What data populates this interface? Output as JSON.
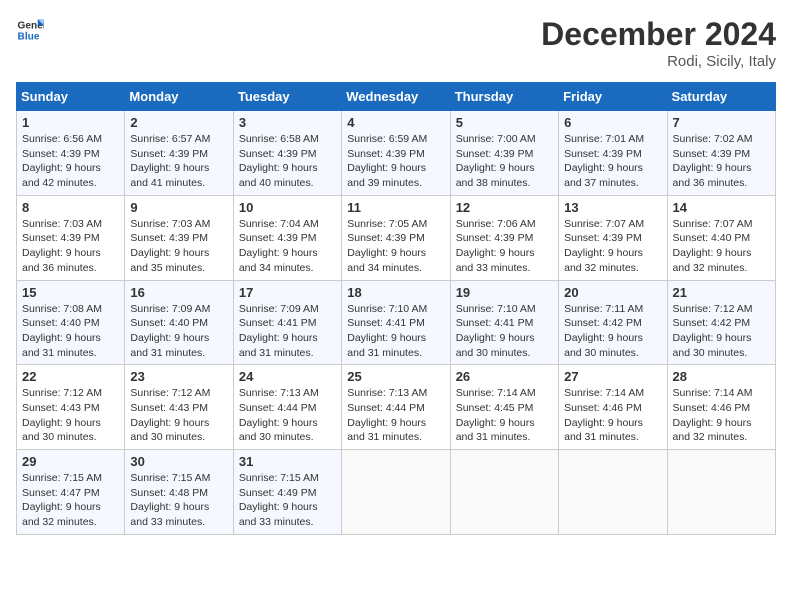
{
  "logo": {
    "line1": "General",
    "line2": "Blue"
  },
  "title": "December 2024",
  "location": "Rodi, Sicily, Italy",
  "weekdays": [
    "Sunday",
    "Monday",
    "Tuesday",
    "Wednesday",
    "Thursday",
    "Friday",
    "Saturday"
  ],
  "weeks": [
    [
      {
        "day": "1",
        "sunrise": "6:56 AM",
        "sunset": "4:39 PM",
        "daylight": "9 hours and 42 minutes."
      },
      {
        "day": "2",
        "sunrise": "6:57 AM",
        "sunset": "4:39 PM",
        "daylight": "9 hours and 41 minutes."
      },
      {
        "day": "3",
        "sunrise": "6:58 AM",
        "sunset": "4:39 PM",
        "daylight": "9 hours and 40 minutes."
      },
      {
        "day": "4",
        "sunrise": "6:59 AM",
        "sunset": "4:39 PM",
        "daylight": "9 hours and 39 minutes."
      },
      {
        "day": "5",
        "sunrise": "7:00 AM",
        "sunset": "4:39 PM",
        "daylight": "9 hours and 38 minutes."
      },
      {
        "day": "6",
        "sunrise": "7:01 AM",
        "sunset": "4:39 PM",
        "daylight": "9 hours and 37 minutes."
      },
      {
        "day": "7",
        "sunrise": "7:02 AM",
        "sunset": "4:39 PM",
        "daylight": "9 hours and 36 minutes."
      }
    ],
    [
      {
        "day": "8",
        "sunrise": "7:03 AM",
        "sunset": "4:39 PM",
        "daylight": "9 hours and 36 minutes."
      },
      {
        "day": "9",
        "sunrise": "7:03 AM",
        "sunset": "4:39 PM",
        "daylight": "9 hours and 35 minutes."
      },
      {
        "day": "10",
        "sunrise": "7:04 AM",
        "sunset": "4:39 PM",
        "daylight": "9 hours and 34 minutes."
      },
      {
        "day": "11",
        "sunrise": "7:05 AM",
        "sunset": "4:39 PM",
        "daylight": "9 hours and 34 minutes."
      },
      {
        "day": "12",
        "sunrise": "7:06 AM",
        "sunset": "4:39 PM",
        "daylight": "9 hours and 33 minutes."
      },
      {
        "day": "13",
        "sunrise": "7:07 AM",
        "sunset": "4:39 PM",
        "daylight": "9 hours and 32 minutes."
      },
      {
        "day": "14",
        "sunrise": "7:07 AM",
        "sunset": "4:40 PM",
        "daylight": "9 hours and 32 minutes."
      }
    ],
    [
      {
        "day": "15",
        "sunrise": "7:08 AM",
        "sunset": "4:40 PM",
        "daylight": "9 hours and 31 minutes."
      },
      {
        "day": "16",
        "sunrise": "7:09 AM",
        "sunset": "4:40 PM",
        "daylight": "9 hours and 31 minutes."
      },
      {
        "day": "17",
        "sunrise": "7:09 AM",
        "sunset": "4:41 PM",
        "daylight": "9 hours and 31 minutes."
      },
      {
        "day": "18",
        "sunrise": "7:10 AM",
        "sunset": "4:41 PM",
        "daylight": "9 hours and 31 minutes."
      },
      {
        "day": "19",
        "sunrise": "7:10 AM",
        "sunset": "4:41 PM",
        "daylight": "9 hours and 30 minutes."
      },
      {
        "day": "20",
        "sunrise": "7:11 AM",
        "sunset": "4:42 PM",
        "daylight": "9 hours and 30 minutes."
      },
      {
        "day": "21",
        "sunrise": "7:12 AM",
        "sunset": "4:42 PM",
        "daylight": "9 hours and 30 minutes."
      }
    ],
    [
      {
        "day": "22",
        "sunrise": "7:12 AM",
        "sunset": "4:43 PM",
        "daylight": "9 hours and 30 minutes."
      },
      {
        "day": "23",
        "sunrise": "7:12 AM",
        "sunset": "4:43 PM",
        "daylight": "9 hours and 30 minutes."
      },
      {
        "day": "24",
        "sunrise": "7:13 AM",
        "sunset": "4:44 PM",
        "daylight": "9 hours and 30 minutes."
      },
      {
        "day": "25",
        "sunrise": "7:13 AM",
        "sunset": "4:44 PM",
        "daylight": "9 hours and 31 minutes."
      },
      {
        "day": "26",
        "sunrise": "7:14 AM",
        "sunset": "4:45 PM",
        "daylight": "9 hours and 31 minutes."
      },
      {
        "day": "27",
        "sunrise": "7:14 AM",
        "sunset": "4:46 PM",
        "daylight": "9 hours and 31 minutes."
      },
      {
        "day": "28",
        "sunrise": "7:14 AM",
        "sunset": "4:46 PM",
        "daylight": "9 hours and 32 minutes."
      }
    ],
    [
      {
        "day": "29",
        "sunrise": "7:15 AM",
        "sunset": "4:47 PM",
        "daylight": "9 hours and 32 minutes."
      },
      {
        "day": "30",
        "sunrise": "7:15 AM",
        "sunset": "4:48 PM",
        "daylight": "9 hours and 33 minutes."
      },
      {
        "day": "31",
        "sunrise": "7:15 AM",
        "sunset": "4:49 PM",
        "daylight": "9 hours and 33 minutes."
      },
      null,
      null,
      null,
      null
    ]
  ],
  "labels": {
    "sunrise": "Sunrise:",
    "sunset": "Sunset:",
    "daylight": "Daylight:"
  }
}
